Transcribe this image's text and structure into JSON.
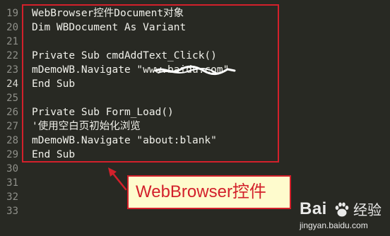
{
  "gutter": {
    "line_numbers": [
      "19",
      "20",
      "21",
      "22",
      "23",
      "24",
      "25",
      "26",
      "27",
      "28",
      "29",
      "30",
      "31",
      "32",
      "33"
    ],
    "active_line": "24"
  },
  "code": {
    "lines": [
      "WebBrowser控件Document对象",
      "Dim WBDocument As Variant",
      "",
      "Private Sub cmdAddText_Click()",
      "mDemoWB.Navigate \"www.baidu.com\"",
      "End Sub",
      "",
      "Private Sub Form_Load()",
      "'使用空白页初始化浏览",
      "mDemoWB.Navigate \"about:blank\"",
      "End Sub"
    ]
  },
  "annotation": {
    "callout_text": "WebBrowser控件",
    "color": "#d3202b",
    "callout_bg": "#fefbcd"
  },
  "watermark": {
    "brand": "Bai",
    "suffix": "经验",
    "site": "jingyan.baidu.com"
  },
  "theme": {
    "background": "#282923",
    "line_number_color": "#8f908a",
    "code_color": "#f0f0ea"
  }
}
